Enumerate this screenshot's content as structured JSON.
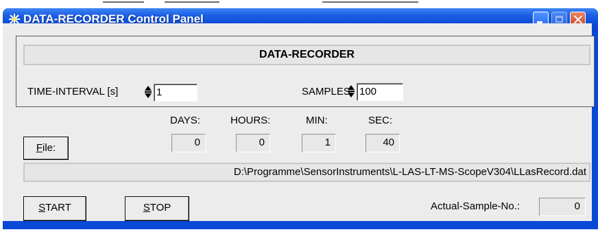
{
  "window": {
    "title": "DATA-RECORDER Control Panel"
  },
  "panel": {
    "header": "DATA-RECORDER",
    "time_interval_label": "TIME-INTERVAL [s]",
    "time_interval_value": "1",
    "samples_label": "SAMPLES",
    "samples_value": "100"
  },
  "file_button": {
    "mnemonic": "F",
    "rest": "ile:"
  },
  "duration": {
    "days_label": "DAYS:",
    "days_value": "0",
    "hours_label": "HOURS:",
    "hours_value": "0",
    "min_label": "MIN:",
    "min_value": "1",
    "sec_label": "SEC:",
    "sec_value": "40"
  },
  "file_path": "D:\\Programme\\SensorInstruments\\L-LAS-LT-MS-ScopeV304\\LLasRecord.dat",
  "start_button": {
    "mnemonic": "S",
    "rest": "TART"
  },
  "stop_button": {
    "mnemonic": "S",
    "rest": "TOP"
  },
  "actual_sample": {
    "label": "Actual-Sample-No.:",
    "value": "0"
  },
  "icons": [
    "app-icon",
    "minimize-icon",
    "maximize-icon",
    "close-icon",
    "spin-up-down-icon"
  ]
}
